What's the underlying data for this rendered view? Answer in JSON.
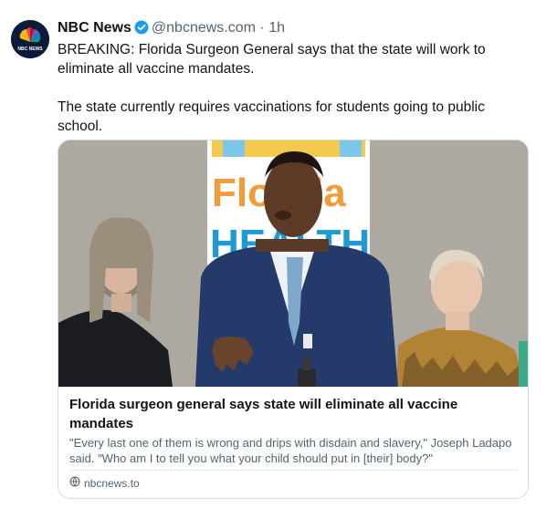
{
  "account": {
    "name": "NBC News",
    "handle": "@nbcnews.com",
    "separator": "·",
    "time": "1h",
    "avatar_text": "NBC NEWS",
    "verified_icon": "verified-badge-icon",
    "verified_color": "#1d9bf0"
  },
  "post": {
    "paragraph1": "BREAKING: Florida Surgeon General says that the state will work to eliminate all vaccine mandates.",
    "paragraph2": "The state currently requires vaccinations for students going to public school."
  },
  "card": {
    "sign_text_top": "Florida",
    "sign_text_bottom": "HEALTH",
    "title": "Florida surgeon general says state will eliminate all vaccine mandates",
    "description": "\"Every last one of them is wrong and drips with disdain and slavery,\" Joseph Ladapo said. \"Who am I to tell you what your child should put in [their] body?\"",
    "domain": "nbcnews.to",
    "link_icon": "link-icon"
  }
}
